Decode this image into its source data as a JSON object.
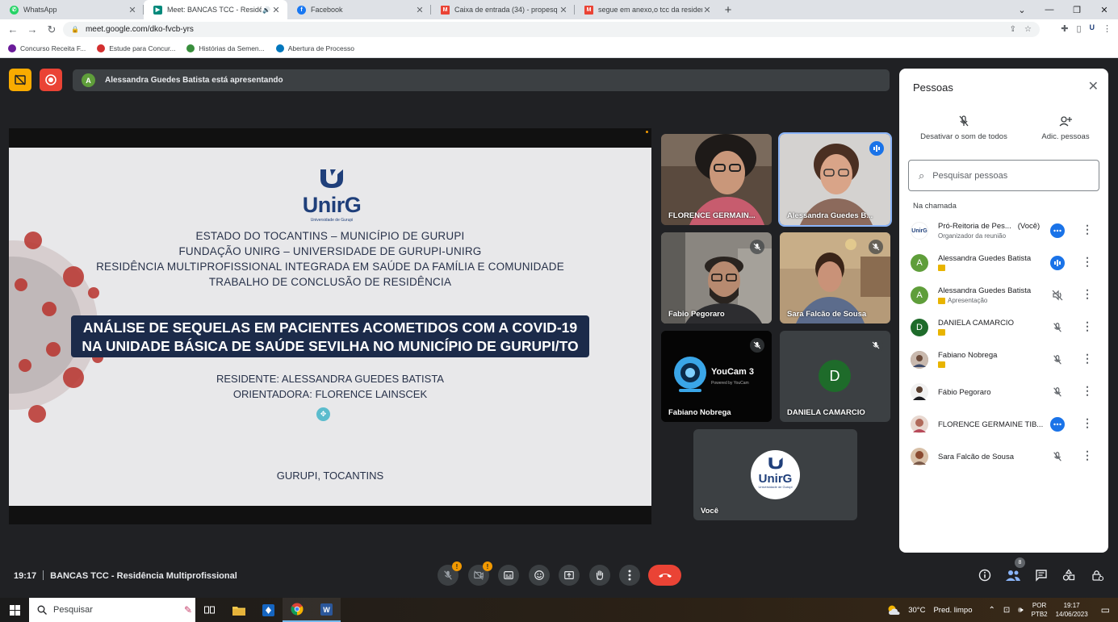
{
  "browser": {
    "tabs": [
      {
        "title": "WhatsApp",
        "color": "#25d366",
        "active": false
      },
      {
        "title": "Meet: BANCAS TCC - Residê",
        "color": "#00897b",
        "active": true
      },
      {
        "title": "Facebook",
        "color": "#1877f2",
        "active": false
      },
      {
        "title": "Caixa de entrada (34) - propesq",
        "color": "#ea4335",
        "active": false
      },
      {
        "title": "segue em anexo,o tcc da residen",
        "color": "#ea4335",
        "active": false
      }
    ],
    "new_tab": "+",
    "url": "meet.google.com/dko-fvcb-yrs",
    "bookmarks": [
      {
        "label": "Concurso Receita F...",
        "color": "#6a1b9a"
      },
      {
        "label": "Estude para Concur...",
        "color": "#d32f2f"
      },
      {
        "label": "Histórias da Semen...",
        "color": "#388e3c"
      },
      {
        "label": "Abertura de Processo",
        "color": "#0277bd"
      }
    ]
  },
  "meet": {
    "presenting_initial": "A",
    "presenting_text": "Alessandra Guedes Batista está apresentando",
    "slide": {
      "logo": "UnirG",
      "logo_sub": "Universidade de Gurupi",
      "lines": [
        "ESTADO DO TOCANTINS – MUNICÍPIO DE GURUPI",
        "FUNDAÇÃO UNIRG – UNIVERSIDADE DE GURUPI-UNIRG",
        "RESIDÊNCIA MULTIPROFISSIONAL INTEGRADA EM SAÚDE DA FAMÍLIA E COMUNIDADE",
        "TRABALHO DE CONCLUSÃO DE RESIDÊNCIA"
      ],
      "title_line1": "ANÁLISE DE SEQUELAS EM PACIENTES ACOMETIDOS COM A COVID-19",
      "title_line2": "NA UNIDADE BÁSICA DE SAÚDE SEVILHA NO MUNICÍPIO DE GURUPI/TO",
      "resident": "RESIDENTE: ALESSANDRA GUEDES BATISTA",
      "advisor": "ORIENTADORA: FLORENCE LAINSCEK",
      "city": "GURUPI, TOCANTINS"
    },
    "tiles": [
      {
        "name": "FLORENCE GERMAIN...",
        "state": "none"
      },
      {
        "name": "Alessandra Guedes B...",
        "state": "speaking"
      },
      {
        "name": "Fabio Pegoraro",
        "state": "muted"
      },
      {
        "name": "Sara Falcão de Sousa",
        "state": "muted"
      },
      {
        "name": "Fabiano Nobrega",
        "state": "muted",
        "camera_text": "YouCam 3",
        "camera_sub": "Powered by YouCam"
      },
      {
        "name": "DANIELA CAMARCIO",
        "state": "muted",
        "initial": "D"
      },
      {
        "name": "Você",
        "state": "none",
        "logo": "UnirG",
        "logo_sub": "Universidade de Gurupi"
      }
    ],
    "bottom": {
      "time": "19:17",
      "meeting_name": "BANCAS TCC - Residência Multiprofissional",
      "mic_warn": "!",
      "cam_warn": "!",
      "people_count": "8"
    }
  },
  "people": {
    "title": "Pessoas",
    "mute_all": "Desativar o som de todos",
    "add_people": "Adic. pessoas",
    "search_placeholder": "Pesquisar pessoas",
    "section": "Na chamada",
    "list": [
      {
        "name": "Pró-Reitoria de Pes...",
        "you": "(Você)",
        "sub": "Organizador da reunião",
        "status": "more",
        "initial": ""
      },
      {
        "name": "Alessandra Guedes Batista",
        "sub": "",
        "status": "speaking",
        "initial": "A"
      },
      {
        "name": "Alessandra Guedes Batista",
        "sub": "Apresentação",
        "status": "off",
        "initial": "A"
      },
      {
        "name": "DANIELA CAMARCIO",
        "sub": "",
        "status": "muted",
        "initial": "D"
      },
      {
        "name": "Fabiano Nobrega",
        "sub": "",
        "status": "muted",
        "initial": ""
      },
      {
        "name": "Fábio Pegoraro",
        "sub": "",
        "status": "muted",
        "initial": ""
      },
      {
        "name": "FLORENCE GERMAINE TIB...",
        "sub": "",
        "status": "more",
        "initial": ""
      },
      {
        "name": "Sara Falcão de Sousa",
        "sub": "",
        "status": "muted",
        "initial": ""
      }
    ]
  },
  "taskbar": {
    "search": "Pesquisar",
    "temp": "30°C",
    "weather": "Pred. limpo",
    "lang1": "POR",
    "lang2": "PTB2",
    "time": "19:17",
    "date": "14/06/2023"
  },
  "colors": {
    "meet_bg": "#202124",
    "end_call": "#ea4335",
    "accent_blue": "#1a73e8",
    "slide_banner": "#1c2b4a",
    "unirg_blue": "#1f3f7a"
  }
}
